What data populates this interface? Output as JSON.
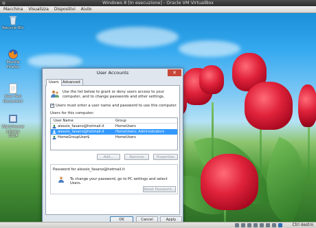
{
  "host": {
    "title": "Windows 8 [In esecuzione] - Oracle VM VirtualBox",
    "menu": [
      "Macchina",
      "Visualizza",
      "Dispositivi",
      "Aiuto"
    ],
    "host_key": "Ctrl destro"
  },
  "desktop": {
    "icons": [
      {
        "label": "Recycle Bin",
        "icon": "recycle-bin-icon"
      },
      {
        "label": "Mozilla Firefox",
        "icon": "firefox-icon"
      },
      {
        "label": "New Text Document",
        "icon": "text-document-icon"
      },
      {
        "label": "Watchtower Library 2014",
        "icon": "watchtower-library-icon"
      }
    ]
  },
  "dialog": {
    "title": "User Accounts",
    "close_glyph": "✕",
    "tabs": [
      "Users",
      "Advanced"
    ],
    "intro": "Use the list below to grant or deny users access to your computer, and to change passwords and other settings.",
    "require_login_label": "Users must enter a user name and password to use this computer.",
    "require_login_checked": true,
    "users_label": "Users for this computer:",
    "columns": [
      "User Name",
      "Group"
    ],
    "users": [
      {
        "name": "alessio_fasano@hotmail.it",
        "group": "HomeUsers",
        "selected": false
      },
      {
        "name": "alessio_fasano@hotmail.it",
        "group": "HomeUsers; Administrators",
        "selected": true
      },
      {
        "name": "HomeGroupUser$",
        "group": "HomeUsers",
        "selected": false
      }
    ],
    "buttons": {
      "add": "Add...",
      "remove": "Remove",
      "properties": "Properties",
      "reset_password": "Reset Password...",
      "ok": "OK",
      "cancel": "Cancel",
      "apply": "Apply"
    },
    "password_section": {
      "title": "Password for alessio_fasano@hotmail.it",
      "text": "To change your password, go to PC settings and select Users."
    }
  }
}
